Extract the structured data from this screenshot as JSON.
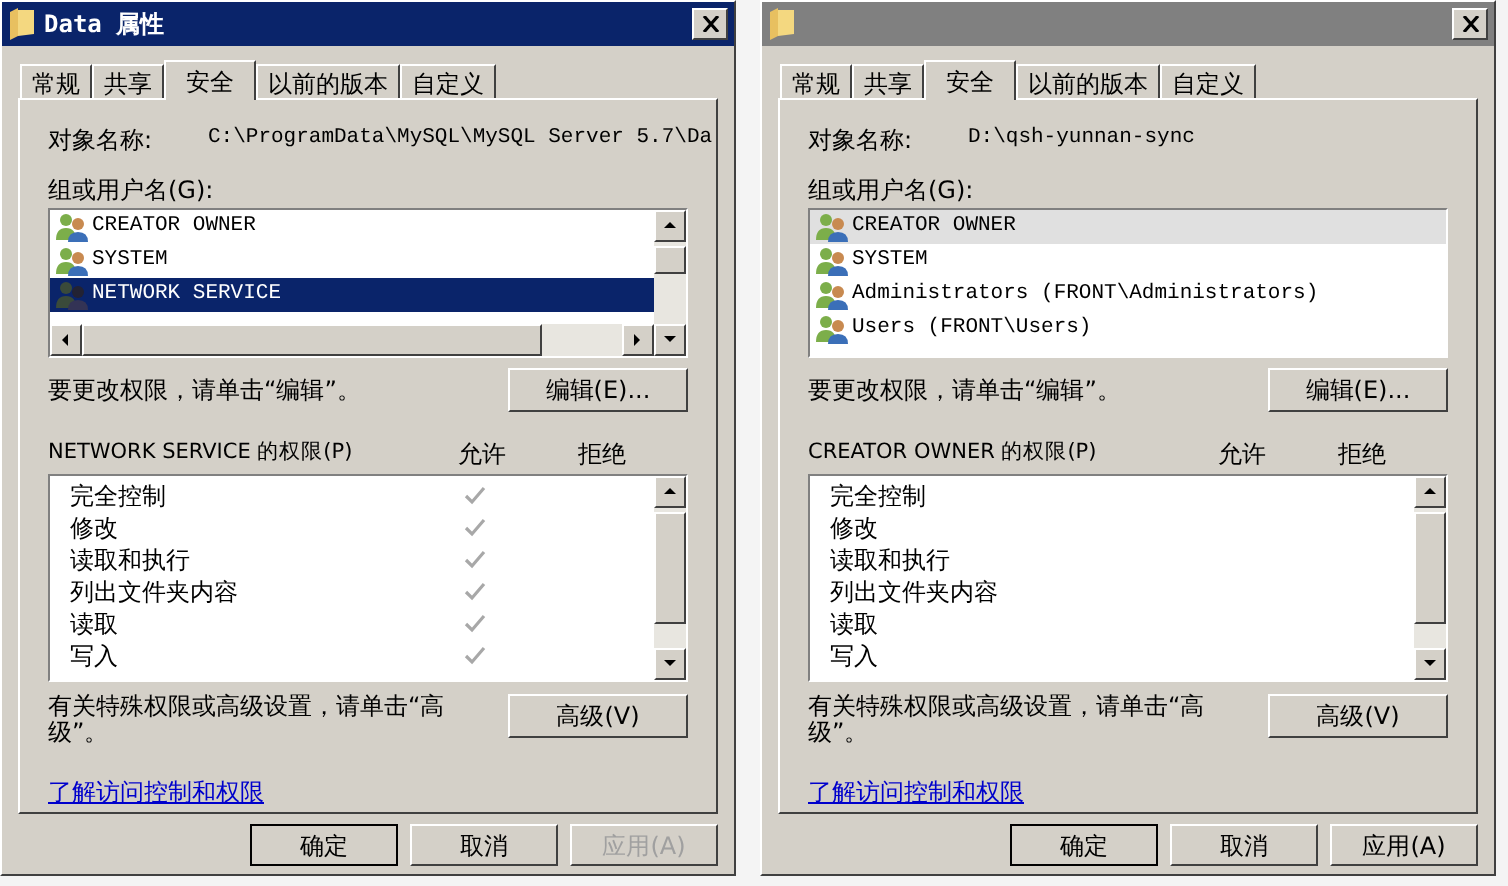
{
  "dialogs": [
    {
      "title": "Data 属性",
      "active": true,
      "list_scrollbars": true,
      "tabs": [
        {
          "label": "常规",
          "selected": false
        },
        {
          "label": "共享",
          "selected": false
        },
        {
          "label": "安全",
          "selected": true
        },
        {
          "label": "以前的版本",
          "selected": false
        },
        {
          "label": "自定义",
          "selected": false
        }
      ],
      "object_label": "对象名称:",
      "object_name": "C:\\ProgramData\\MySQL\\MySQL Server 5.7\\Da",
      "groups_label": "组或用户名(G):",
      "users": [
        {
          "name": "CREATOR OWNER",
          "selected": false
        },
        {
          "name": "SYSTEM",
          "selected": false
        },
        {
          "name": "NETWORK SERVICE",
          "selected": true
        }
      ],
      "edit_hint": "要更改权限，请单击“编辑”。",
      "edit_button": "编辑(E)...",
      "permissions_label": "NETWORK SERVICE 的权限(P)",
      "allow_header": "允许",
      "deny_header": "拒绝",
      "permissions": [
        {
          "name": "完全控制",
          "allow": true
        },
        {
          "name": "修改",
          "allow": true
        },
        {
          "name": "读取和执行",
          "allow": true
        },
        {
          "name": "列出文件夹内容",
          "allow": true
        },
        {
          "name": "读取",
          "allow": true
        },
        {
          "name": "写入",
          "allow": true
        }
      ],
      "advanced_hint": "有关特殊权限或高级设置，请单击“高级”。",
      "advanced_button": "高级(V)",
      "link": "了解访问控制和权限",
      "buttons": [
        {
          "label": "确定",
          "default": true,
          "disabled": false
        },
        {
          "label": "取消",
          "default": false,
          "disabled": false
        },
        {
          "label": "应用(A)",
          "default": false,
          "disabled": true
        }
      ]
    },
    {
      "active": false,
      "list_scrollbars": false,
      "tabs": [
        {
          "label": "常规",
          "selected": false
        },
        {
          "label": "共享",
          "selected": false
        },
        {
          "label": "安全",
          "selected": true
        },
        {
          "label": "以前的版本",
          "selected": false
        },
        {
          "label": "自定义",
          "selected": false
        }
      ],
      "object_label": "对象名称:",
      "object_name": "D:\\qsh-yunnan-sync",
      "groups_label": "组或用户名(G):",
      "users": [
        {
          "name": "CREATOR OWNER",
          "selected": true
        },
        {
          "name": "SYSTEM",
          "selected": false
        },
        {
          "name": "Administrators (FRONT\\Administrators)",
          "selected": false
        },
        {
          "name": "Users (FRONT\\Users)",
          "selected": false
        }
      ],
      "edit_hint": "要更改权限，请单击“编辑”。",
      "edit_button": "编辑(E)...",
      "permissions_label": "CREATOR OWNER 的权限(P)",
      "allow_header": "允许",
      "deny_header": "拒绝",
      "permissions": [
        {
          "name": "完全控制",
          "allow": false
        },
        {
          "name": "修改",
          "allow": false
        },
        {
          "name": "读取和执行",
          "allow": false
        },
        {
          "name": "列出文件夹内容",
          "allow": false
        },
        {
          "name": "读取",
          "allow": false
        },
        {
          "name": "写入",
          "allow": false
        }
      ],
      "advanced_hint": "有关特殊权限或高级设置，请单击“高级”。",
      "advanced_button": "高级(V)",
      "link": "了解访问控制和权限",
      "buttons": [
        {
          "label": "确定",
          "default": true,
          "disabled": false
        },
        {
          "label": "取消",
          "default": false,
          "disabled": false
        },
        {
          "label": "应用(A)",
          "default": false,
          "disabled": false
        }
      ]
    }
  ]
}
